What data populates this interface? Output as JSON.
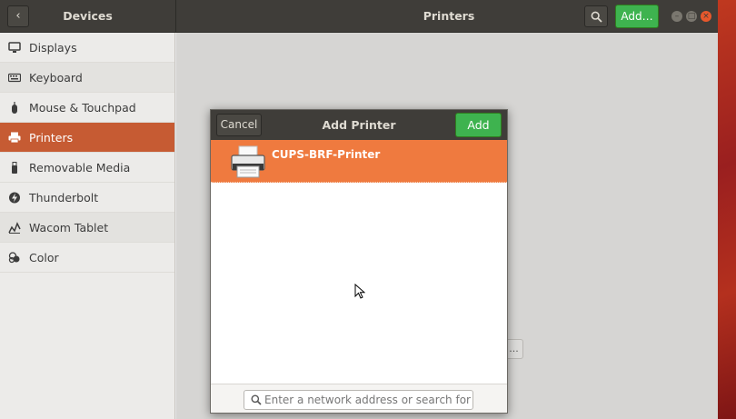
{
  "header": {
    "back_icon": "chevron-left-icon",
    "left_title": "Devices",
    "title": "Printers",
    "search_icon": "search-icon",
    "add_label": "Add…"
  },
  "sidebar": {
    "items": [
      {
        "label": "Displays",
        "icon": "display-icon"
      },
      {
        "label": "Keyboard",
        "icon": "keyboard-icon"
      },
      {
        "label": "Mouse & Touchpad",
        "icon": "mouse-icon"
      },
      {
        "label": "Printers",
        "icon": "printer-icon",
        "active": true
      },
      {
        "label": "Removable Media",
        "icon": "usb-icon"
      },
      {
        "label": "Thunderbolt",
        "icon": "thunderbolt-icon"
      },
      {
        "label": "Wacom Tablet",
        "icon": "tablet-icon"
      },
      {
        "label": "Color",
        "icon": "color-icon"
      }
    ]
  },
  "content": {
    "ghost_button_label": "..."
  },
  "dialog": {
    "title": "Add Printer",
    "cancel_label": "Cancel",
    "add_label": "Add",
    "printers": [
      {
        "name": "CUPS-BRF-Printer",
        "selected": true
      }
    ],
    "search_placeholder": "Enter a network address or search for a…"
  },
  "colors": {
    "accent": "#ef7a3f",
    "sidebar_active": "#c65b33",
    "add_green": "#3eb34f",
    "headerbar": "#3f3d39"
  }
}
